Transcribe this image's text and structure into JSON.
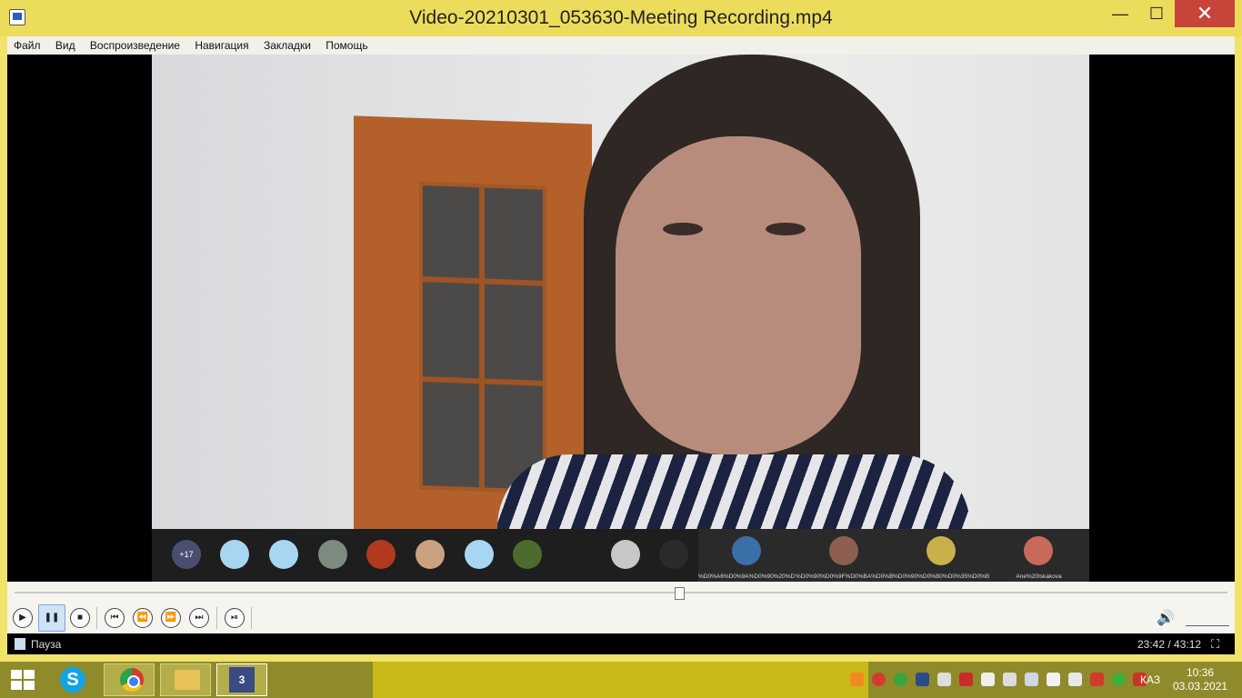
{
  "window": {
    "title": "Video-20210301_053630-Meeting Recording.mp4",
    "min_glyph": "—",
    "max_glyph": "☐",
    "close_glyph": "✕"
  },
  "menu": [
    "Файл",
    "Вид",
    "Воспроизведение",
    "Навигация",
    "Закладки",
    "Помощь"
  ],
  "video": {
    "more_count": "+17",
    "named_participants": [
      "%D0%A6%D0%9A%D0%90%20%D…",
      "%D0%90%D0%9F%D0%BA%D0%B0…",
      "%D0%90%D0%B0%D0%35%D0%B…",
      "Ane%20Iskakova"
    ]
  },
  "playback": {
    "progress_fraction": 0.548,
    "status": "Пауза",
    "time": "23:42 / 43:12"
  },
  "controls": {
    "play_glyph": "▶",
    "pause_glyph": "❚❚",
    "stop_glyph": "■",
    "prev_glyph": "⏮",
    "rewind_glyph": "⏪",
    "forward_glyph": "⏩",
    "next_glyph": "⏭",
    "frame_step_glyph": "⏯",
    "volume_glyph": "🔊"
  },
  "taskbar": {
    "language": "КАЗ",
    "time": "10:36",
    "date": "03.03.2021",
    "skype_letter": "S",
    "mpc_label": "3"
  },
  "colors": {
    "title_bar": "#ecdc5c",
    "close_button": "#c7443a",
    "taskbar": "#c9b818"
  }
}
